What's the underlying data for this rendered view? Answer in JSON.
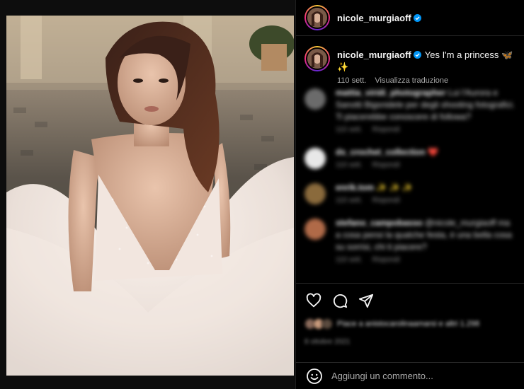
{
  "post": {
    "author": "nicole_murgiaoff",
    "caption_text": "Yes I'm a princess 🦋 ✨",
    "time_ago": "110 sett.",
    "translate_label": "Visualizza traduzione"
  },
  "comments": [
    {
      "user": "mattia_viridi_photographer",
      "text": "Lui l'Aurora e Sanotti Bigsnidele per degli shooting fotografici. Ti piacerebbe conoscere di followa?",
      "time": "110 sett.",
      "reply": "Rispondi",
      "avatar_color": "#6b6b6b"
    },
    {
      "user": "ds_crochet_collection",
      "text": "❤️",
      "time": "110 sett.",
      "reply": "Rispondi",
      "avatar_color": "#e8e8e8"
    },
    {
      "user": "enrik.tom",
      "text": "✨ ✨ ✨",
      "time": "110 sett.",
      "reply": "Rispondi",
      "avatar_color": "#8a6a3c"
    },
    {
      "user": "stefano_campobasso",
      "text": "@nicole_murgiaoff ma a cosa pensi la qualche festa, è una bella cosa su sorrisi, chi ti piacere?",
      "time": "110 sett.",
      "reply": "Rispondi",
      "avatar_color": "#b06a48"
    }
  ],
  "likes": {
    "text": "Piace a anistocarolinaamarsi e altri 1.298",
    "date": "8 ottobre 2021"
  },
  "add_comment": {
    "placeholder": "Aggiungi un commento..."
  },
  "colors": {
    "background": "#000000",
    "verified": "#0095f6",
    "text_secondary": "#a8a8a8"
  },
  "icons": [
    "heart-icon",
    "comment-icon",
    "share-icon",
    "emoji-icon",
    "verified-icon"
  ]
}
